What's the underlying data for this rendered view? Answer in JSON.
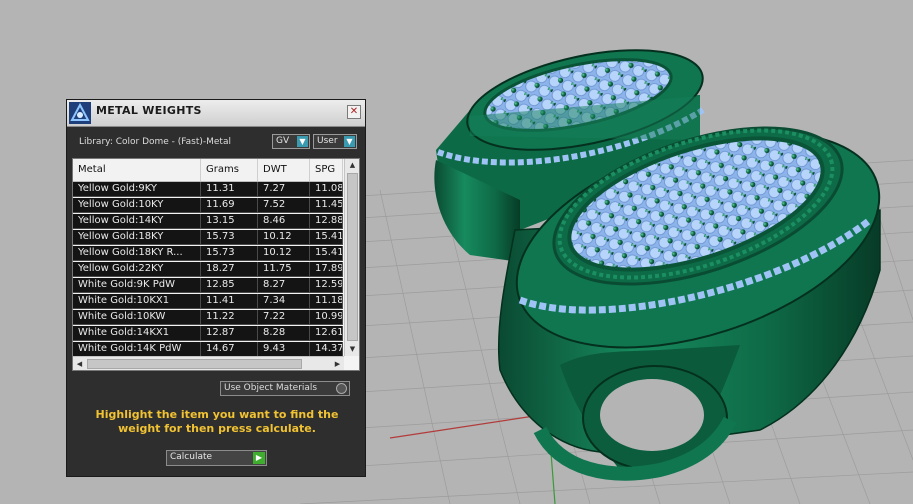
{
  "window": {
    "title": "METAL WEIGHTS",
    "close_label": "✕"
  },
  "library": {
    "label": "Library: Color Dome - (Fast)-Metal",
    "combo_gv": "GV",
    "combo_user": "User"
  },
  "table": {
    "columns": [
      "Metal",
      "Grams",
      "DWT",
      "SPG"
    ],
    "rows": [
      [
        "Yellow Gold:9KY",
        "11.31",
        "7.27",
        "11.08"
      ],
      [
        "Yellow Gold:10KY",
        "11.69",
        "7.52",
        "11.45"
      ],
      [
        "Yellow Gold:14KY",
        "13.15",
        "8.46",
        "12.88"
      ],
      [
        "Yellow Gold:18KY",
        "15.73",
        "10.12",
        "15.41"
      ],
      [
        "Yellow Gold:18KY R...",
        "15.73",
        "10.12",
        "15.41"
      ],
      [
        "Yellow Gold:22KY",
        "18.27",
        "11.75",
        "17.89"
      ],
      [
        "White Gold:9K PdW",
        "12.85",
        "8.27",
        "12.59"
      ],
      [
        "White Gold:10KX1",
        "11.41",
        "7.34",
        "11.18"
      ],
      [
        "White Gold:10KW",
        "11.22",
        "7.22",
        "10.99"
      ],
      [
        "White Gold:14KX1",
        "12.87",
        "8.28",
        "12.61"
      ],
      [
        "White Gold:14K PdW",
        "14.67",
        "9.43",
        "14.37"
      ]
    ]
  },
  "options": {
    "use_object_materials": "Use Object Materials"
  },
  "instruction": "Highlight the item you want to find the weight for then press calculate.",
  "calculate": {
    "label": "Calculate"
  },
  "icons": {
    "logo": "app-logo-icon",
    "close": "close-icon",
    "dropdown": "chevron-down-icon",
    "go": "arrow-right-icon"
  },
  "colors": {
    "panel_bg": "#2e2e2e",
    "row_bg": "#141414",
    "instruction_text": "#f1c232",
    "ring_green": "#127a55",
    "gem_blue": "#8fb8f0",
    "viewport_bg": "#b4b4b4"
  }
}
